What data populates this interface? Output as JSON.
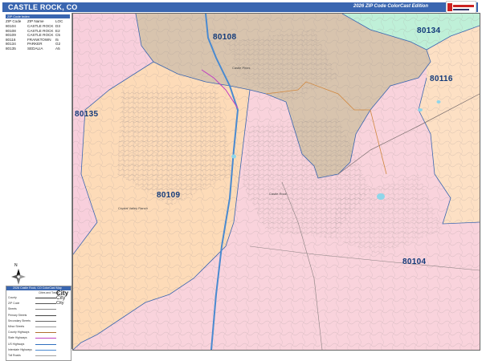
{
  "header": {
    "title": "CASTLE ROCK, CO",
    "edition": "2026 ZIP Code ColorCast Edition"
  },
  "zip_table": {
    "heading": "ZIP Code Index",
    "columns": [
      "ZIP Code",
      "ZIP Name",
      "LOC"
    ],
    "rows": [
      [
        "80104",
        "CASTLE ROCK",
        "D3"
      ],
      [
        "80108",
        "CASTLE ROCK",
        "E2"
      ],
      [
        "80109",
        "CASTLE ROCK",
        "C5"
      ],
      [
        "80116",
        "FRANKTOWN",
        "I5"
      ],
      [
        "80134",
        "PARKER",
        "G2"
      ],
      [
        "80135",
        "SEDALIA",
        "A5"
      ]
    ]
  },
  "north_arrow": "N",
  "legend": {
    "title": "2026 Castle Rock, CO ColorCast Map",
    "subtitle": "Cities and Towns",
    "city_samples": [
      "City",
      "City",
      "City"
    ],
    "items": [
      {
        "label": "County",
        "color": "#333333"
      },
      {
        "label": "ZIP Code",
        "color": "#555555"
      },
      {
        "label": "Streets",
        "color": "#888888"
      },
      {
        "label": "Primary Streets",
        "color": "#444444"
      },
      {
        "label": "Secondary Streets",
        "color": "#666666"
      },
      {
        "label": "Minor Streets",
        "color": "#999999"
      },
      {
        "label": "County Highways",
        "color": "#b07030"
      },
      {
        "label": "State Highways",
        "color": "#c040c0"
      },
      {
        "label": "US Highways",
        "color": "#3070c0"
      },
      {
        "label": "Interstate Highways",
        "color": "#4a8ad0"
      },
      {
        "label": "Toll Roads",
        "color": "#a0a0a0"
      }
    ]
  },
  "zips": [
    {
      "code": "80108",
      "color": "#d8c4ae"
    },
    {
      "code": "80134",
      "color": "#bff0d8"
    },
    {
      "code": "80116",
      "color": "#fde0c4"
    },
    {
      "code": "80135",
      "color": "#f8cfdc"
    },
    {
      "code": "80109",
      "color": "#fddbb8"
    },
    {
      "code": "80104",
      "color": "#f9d3dc"
    }
  ],
  "places": [
    "Castle Rock",
    "Castle Pines",
    "Crystal Valley Ranch"
  ]
}
